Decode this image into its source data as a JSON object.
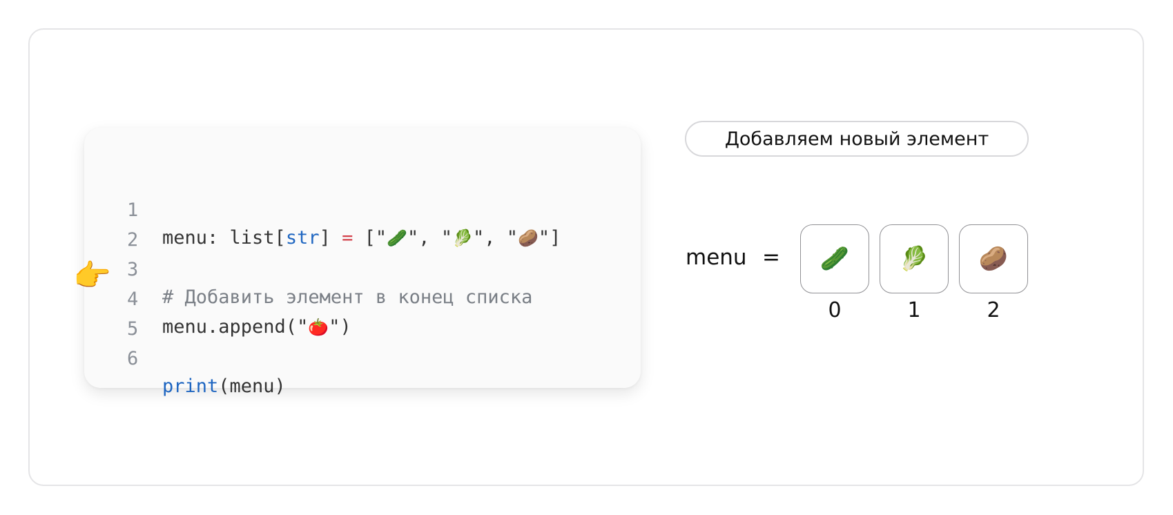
{
  "code": {
    "lines": [
      {
        "num": "1",
        "prefix": "menu: list[",
        "type": "str",
        "mid": "] ",
        "eq": "=",
        "rest_open": " [\"",
        "e1": "🥒",
        "sep1": "\", \"",
        "e2": "🥬",
        "sep2": "\", \"",
        "e3": "🥔",
        "rest_close": "\"]"
      },
      {
        "num": "2"
      },
      {
        "num": "3",
        "comment": "# Добавить элемент в конец списка"
      },
      {
        "num": "4",
        "prefix": "menu.append(\"",
        "e1": "🍅",
        "suffix": "\")"
      },
      {
        "num": "5"
      },
      {
        "num": "6",
        "func": "print",
        "suffix": "(menu)"
      }
    ],
    "pointer": "👉"
  },
  "panel": {
    "title": "Добавляем новый элемент",
    "var_name": "menu",
    "equals": "=",
    "cells": [
      {
        "value": "🥒",
        "index": "0"
      },
      {
        "value": "🥬",
        "index": "1"
      },
      {
        "value": "🥔",
        "index": "2"
      }
    ]
  }
}
